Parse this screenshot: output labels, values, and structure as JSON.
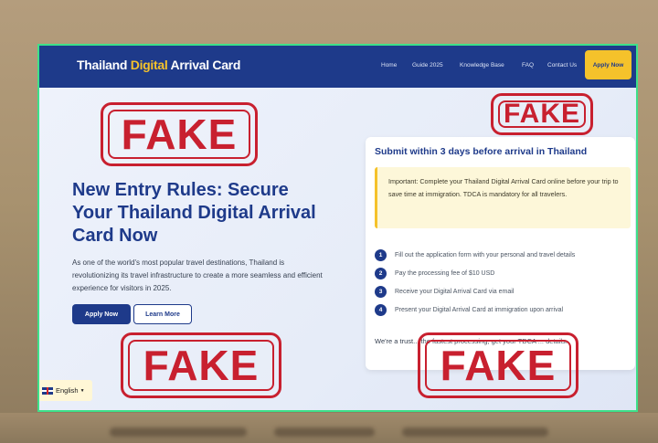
{
  "header": {
    "logo_part1": "Thailand",
    "logo_part2": "Digital",
    "logo_part3": "Arrival Card",
    "nav": [
      "Home",
      "Guide 2025",
      "Knowledge Base",
      "FAQ",
      "Contact Us"
    ],
    "apply_button": "Apply Now"
  },
  "hero": {
    "title": "New Entry Rules: Secure Your Thailand Digital Arrival Card Now",
    "description": "As one of the world's most popular travel destinations, Thailand is revolutionizing its travel infrastructure to create a more seamless and efficient experience for visitors in 2025.",
    "apply_button": "Apply Now",
    "learn_button": "Learn More"
  },
  "card": {
    "title": "Submit within 3 days before arrival in Thailand",
    "notice": "Important: Complete your Thailand Digital Arrival Card online before your trip to save time at immigration. TDCA is mandatory for all travelers.",
    "steps": [
      {
        "num": "1",
        "text": "Fill out the application form with your personal and travel details"
      },
      {
        "num": "2",
        "text": "Pay the processing fee of $10 USD"
      },
      {
        "num": "3",
        "text": "Receive your Digital Arrival Card via email"
      },
      {
        "num": "4",
        "text": "Present your Digital Arrival Card at immigration upon arrival"
      }
    ],
    "trust_text": "We're a trust... the fastest processing, get your TDCA ... details."
  },
  "language": {
    "label": "English"
  },
  "stamps": {
    "text": "FAKE"
  },
  "colors": {
    "nav_bg": "#1e3a8a",
    "accent": "#f5c22b",
    "stamp": "#c8202f",
    "frame": "#3ee08a"
  }
}
